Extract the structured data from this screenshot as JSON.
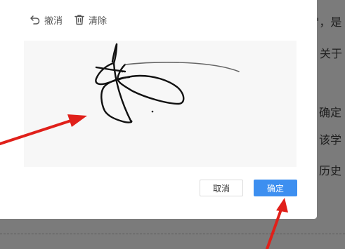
{
  "toolbar": {
    "undo_label": "撤消",
    "clear_label": "清除"
  },
  "buttons": {
    "cancel_label": "取消",
    "ok_label": "确定"
  },
  "background_doc": {
    "fragments": [
      "\"，是",
      "关于",
      "确定",
      "该学",
      "历史"
    ]
  },
  "colors": {
    "primary": "#3d8ff0",
    "annotation_arrow": "#e0201a"
  }
}
